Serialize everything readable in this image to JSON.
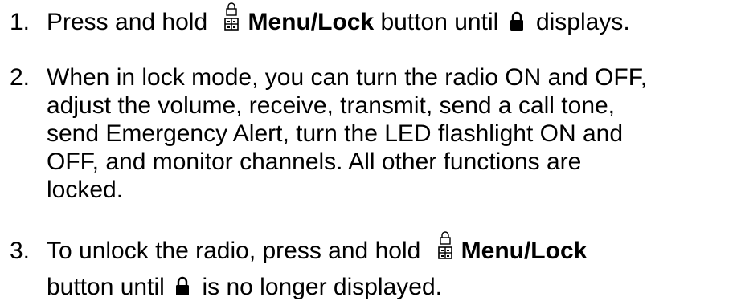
{
  "steps": [
    {
      "number": "1.",
      "text_before_icon": "Press and hold ",
      "icon": "menu-lock-icon",
      "bold_label": "Menu/Lock",
      "text_after_bold": " button until ",
      "status_icon": "lock-icon",
      "text_end": " displays."
    },
    {
      "number": "2.",
      "lines": [
        "When in lock mode, you can turn the radio ON and OFF,",
        "adjust the volume, receive, transmit, send a call tone,",
        "send Emergency Alert, turn the LED flashlight ON and",
        "OFF, and monitor channels. All other functions are",
        "locked."
      ]
    },
    {
      "number": "3.",
      "text_before_icon": "To unlock the radio, press and hold ",
      "icon": "menu-lock-icon",
      "bold_label": "Menu/Lock",
      "line2_before_icon": "button until ",
      "status_icon": "lock-icon",
      "line2_end": " is no longer displayed."
    }
  ]
}
